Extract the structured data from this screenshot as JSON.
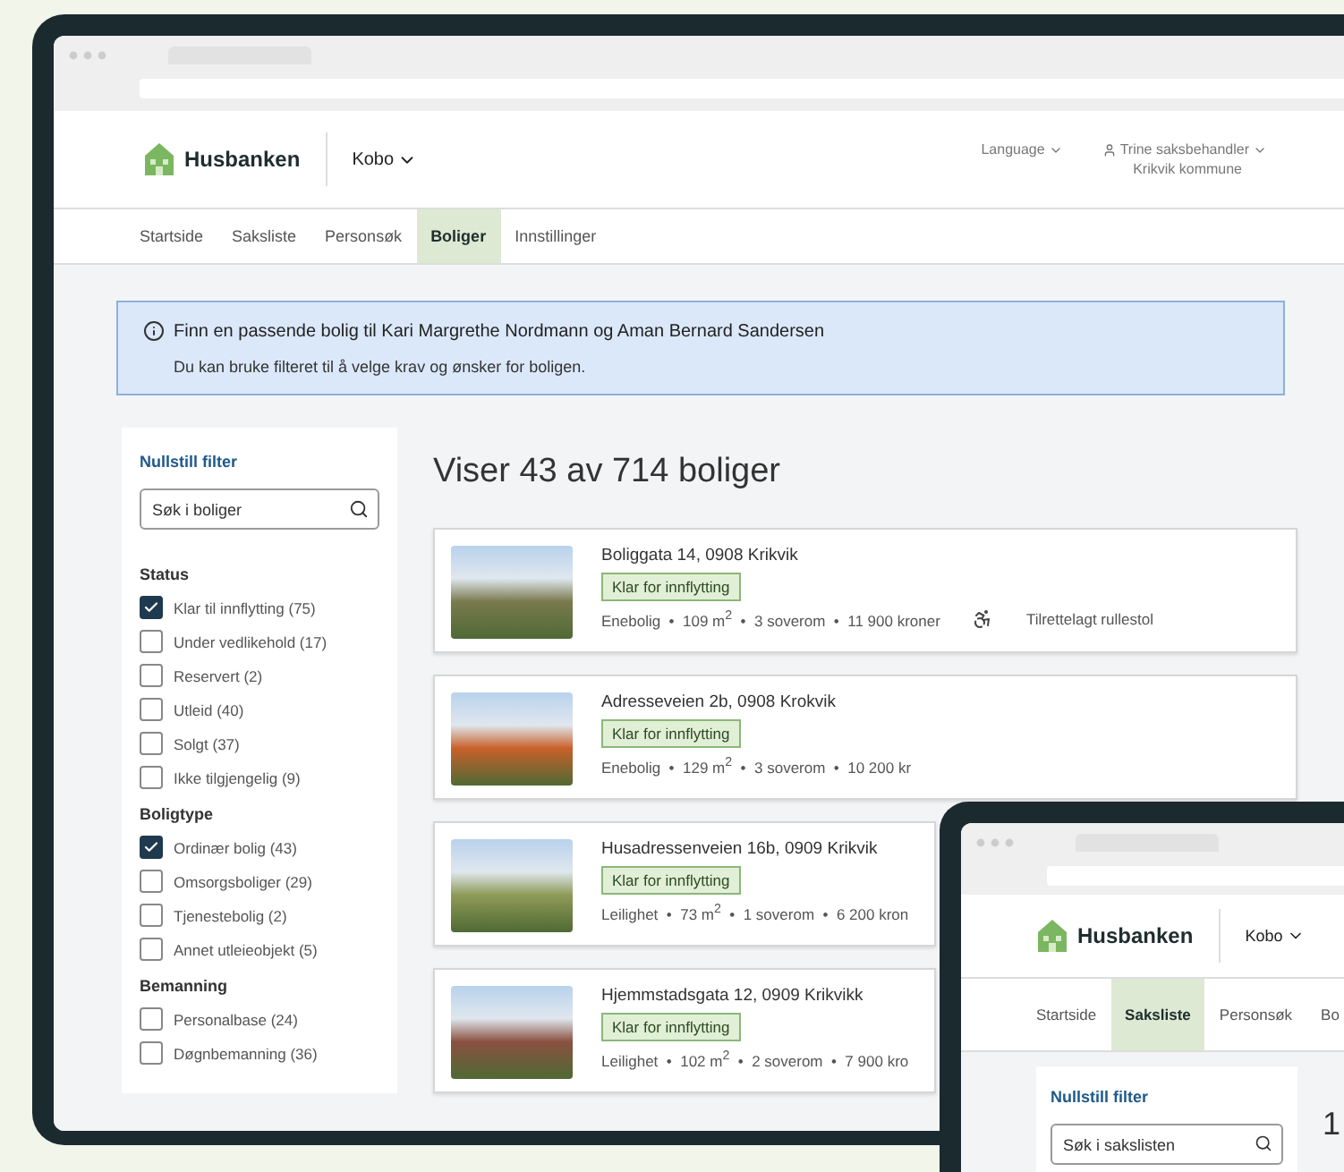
{
  "header": {
    "logo": "Husbanken",
    "app_menu": "Kobo",
    "language": "Language",
    "user": "Trine saksbehandler",
    "organization": "Krikvik kommune"
  },
  "nav": [
    {
      "label": "Startside",
      "selected": false
    },
    {
      "label": "Saksliste",
      "selected": false
    },
    {
      "label": "Personsøk",
      "selected": false
    },
    {
      "label": "Boliger",
      "selected": true
    },
    {
      "label": "Innstillinger",
      "selected": false
    }
  ],
  "info_banner": {
    "title": "Finn en passende bolig til Kari Margrethe Nordmann og Aman Bernard Sandersen",
    "text": "Du kan bruke filteret til å velge krav og ønsker for boligen."
  },
  "filter": {
    "reset": "Nullstill filter",
    "search": {
      "placeholder": "Søk i boliger"
    },
    "groups": [
      {
        "title": "Status",
        "options": [
          {
            "label": "Klar til innflytting (75)",
            "checked": true
          },
          {
            "label": "Under vedlikehold (17)",
            "checked": false
          },
          {
            "label": "Reservert (2)",
            "checked": false
          },
          {
            "label": "Utleid (40)",
            "checked": false
          },
          {
            "label": "Solgt (37)",
            "checked": false
          },
          {
            "label": "Ikke tilgjengelig (9)",
            "checked": false
          }
        ]
      },
      {
        "title": "Boligtype",
        "options": [
          {
            "label": "Ordinær bolig (43)",
            "checked": true
          },
          {
            "label": "Omsorgsboliger (29)",
            "checked": false
          },
          {
            "label": "Tjenestebolig (2)",
            "checked": false
          },
          {
            "label": "Annet utleieobjekt (5)",
            "checked": false
          }
        ]
      },
      {
        "title": "Bemanning",
        "options": [
          {
            "label": "Personalbase (24)",
            "checked": false
          },
          {
            "label": "Døgnbemanning (36)",
            "checked": false
          }
        ]
      }
    ]
  },
  "results": {
    "heading": "Viser 43 av 714 boliger",
    "listings": [
      {
        "address": "Boliggata 14, 0908 Krikvik",
        "status": "Klar for innflytting",
        "meta": "Enebolig  •  109 m$^{2}$  •  3 soverom  •  11 900 kroner",
        "accessibility": "Tilrettelagt rullestol"
      },
      {
        "address": "Adresseveien 2b, 0908 Krokvik",
        "status": "Klar for innflytting",
        "meta": "Enebolig  •  129 m$^{2}$  •  3 soverom  •  10 200 kr"
      },
      {
        "address": "Husadressenveien 16b, 0909 Krikvik",
        "status": "Klar for innflytting",
        "meta": "Leilighet  •  73 m$^{2}$  •  1 soverom  •  6 200 kron"
      },
      {
        "address": "Hjemmstadsgata 12, 0909 Krikvikk",
        "status": "Klar for innflytting",
        "meta": "Leilighet  •  102 m$^{2}$  •  2 soverom  •  7 900 kro"
      }
    ]
  },
  "second_window": {
    "header": {
      "logo": "Husbanken",
      "app_menu": "Kobo"
    },
    "nav": [
      {
        "label": "Startside",
        "selected": false
      },
      {
        "label": "Saksliste",
        "selected": true
      },
      {
        "label": "Personsøk",
        "selected": false
      },
      {
        "label": "Bo",
        "selected": false
      }
    ],
    "filter": {
      "reset": "Nullstill filter",
      "search": {
        "placeholder": "Søk i sakslisten"
      }
    },
    "heading": "1"
  }
}
